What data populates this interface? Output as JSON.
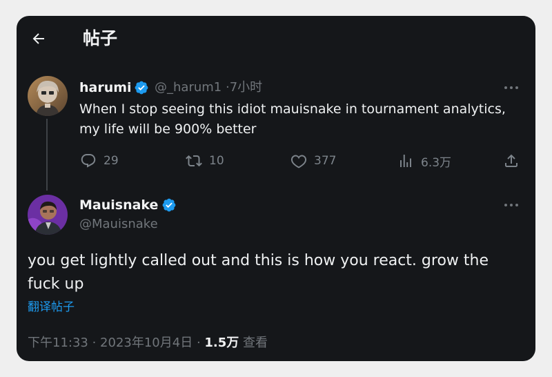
{
  "header": {
    "title": "帖子"
  },
  "original_post": {
    "display_name": "harumi",
    "handle": "@_harum1",
    "separator": "·",
    "time": "7小时",
    "text": "When I stop seeing this idiot mauisnake in tournament analytics, my life will be 900% better",
    "stats": {
      "replies": "29",
      "reposts": "10",
      "likes": "377",
      "views": "6.3万"
    }
  },
  "reply_post": {
    "display_name": "Mauisnake",
    "handle": "@Mauisnake",
    "text": "you get lightly called out and this is how you react. grow the fuck up",
    "translate_label": "翻译帖子",
    "timestamp": "下午11:33 · 2023年10月4日",
    "dot": "·",
    "views_count": "1.5万",
    "views_label": "查看"
  },
  "colors": {
    "background": "#15171a",
    "accent": "#1d9bf0",
    "muted": "#71767b",
    "text": "#e7e9ea"
  },
  "icons": {
    "back": "arrow-left-icon",
    "verified": "verified-badge-icon",
    "more": "more-horizontal-icon",
    "reply": "reply-icon",
    "repost": "repost-icon",
    "like": "heart-icon",
    "views": "views-chart-icon",
    "share": "share-icon"
  }
}
